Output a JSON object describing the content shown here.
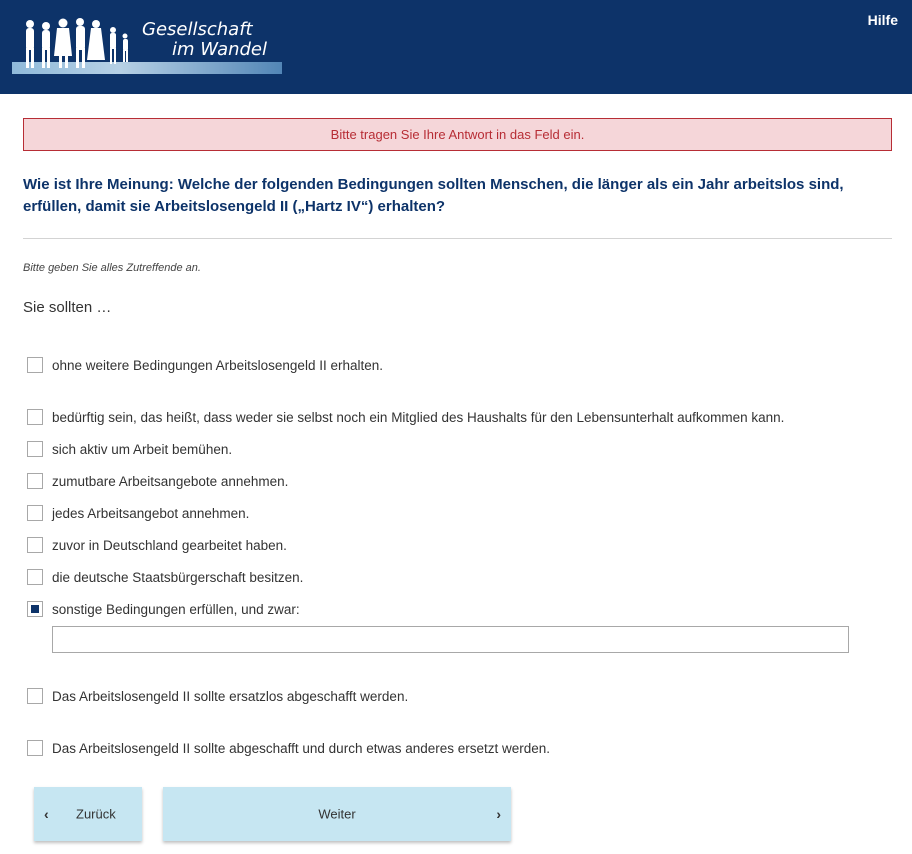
{
  "header": {
    "logo": {
      "line1": "Gesellschaft",
      "line2": "im Wandel"
    },
    "help_label": "Hilfe"
  },
  "error": "Bitte tragen Sie Ihre Antwort in das Feld ein.",
  "question": "Wie ist Ihre Meinung: Welche der folgenden Bedingungen sollten Menschen, die länger als ein Jahr arbeitslos sind, erfüllen, damit sie Arbeitslosengeld II („Hartz IV“) erhalten?",
  "instruction": "Bitte geben Sie alles Zutreffende an.",
  "stem": "Sie sollten …",
  "options": [
    {
      "label": "ohne weitere Bedingungen Arbeitslosengeld II erhalten.",
      "checked": false
    },
    {
      "label": "bedürftig sein, das heißt, dass weder sie selbst noch ein Mitglied des Haushalts für den Lebensunterhalt aufkommen kann.",
      "checked": false
    },
    {
      "label": "sich aktiv um Arbeit bemühen.",
      "checked": false
    },
    {
      "label": "zumutbare Arbeitsangebote annehmen.",
      "checked": false
    },
    {
      "label": "jedes Arbeitsangebot annehmen.",
      "checked": false
    },
    {
      "label": "zuvor in Deutschland gearbeitet haben.",
      "checked": false
    },
    {
      "label": "die deutsche Staatsbürgerschaft besitzen.",
      "checked": false
    },
    {
      "label": "sonstige Bedingungen erfüllen, und zwar:",
      "checked": true
    },
    {
      "label": "Das Arbeitslosengeld II sollte ersatzlos abgeschafft werden.",
      "checked": false
    },
    {
      "label": "Das Arbeitslosengeld II sollte abgeschafft und durch etwas anderes ersetzt werden.",
      "checked": false
    }
  ],
  "other_input": {
    "value": "",
    "placeholder": ""
  },
  "buttons": {
    "back_label": "Zurück",
    "next_label": "Weiter"
  },
  "colors": {
    "header_bg": "#0d3369",
    "error_text": "#b72d35",
    "error_bg": "#f5d6d9",
    "button_bg": "#c6e6f2"
  }
}
